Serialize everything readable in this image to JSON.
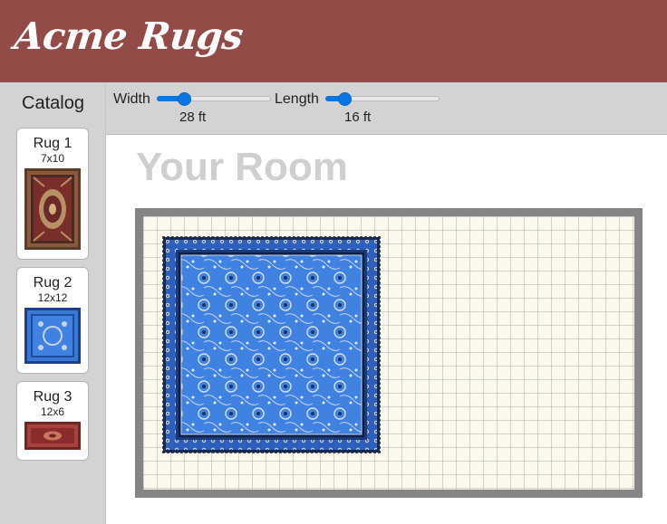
{
  "header": {
    "brand": "Acme Rugs"
  },
  "sidebar": {
    "title": "Catalog",
    "rugs": [
      {
        "name": "Rug 1",
        "size": "7x10",
        "pattern": "red-medallion-rug"
      },
      {
        "name": "Rug 2",
        "size": "12x12",
        "pattern": "blue-floral-rug"
      },
      {
        "name": "Rug 3",
        "size": "12x6",
        "pattern": "red-runner-rug"
      }
    ]
  },
  "toolbar": {
    "width": {
      "label": "Width",
      "value_text": "28 ft",
      "fraction": 0.24
    },
    "length": {
      "label": "Length",
      "value_text": "16 ft",
      "fraction": 0.17
    }
  },
  "room": {
    "title": "Your Room",
    "placed_rug": "Rug 2"
  },
  "colors": {
    "header": "#924b46",
    "sidebar": "#d3d3d3",
    "slider_accent": "#0b75e0",
    "floor": "#fcf9ec",
    "wall": "#858585",
    "rug_blue": "#2f6fd8",
    "rug_red": "#8b2c2c"
  }
}
